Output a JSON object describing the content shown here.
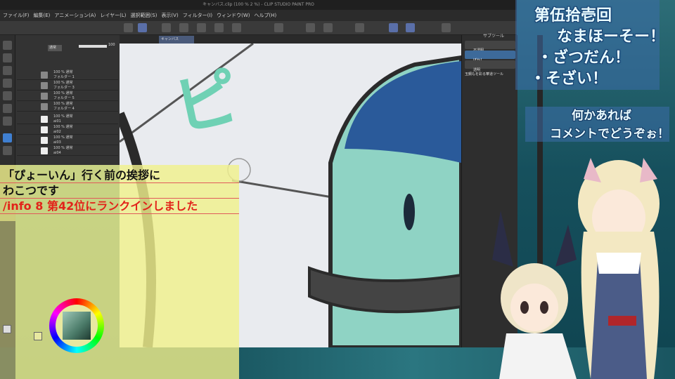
{
  "app": {
    "title": "キャンバス.clip (100 % 2 %) - CLIP STUDIO PAINT PRO",
    "menu": [
      "ファイル(F)",
      "編集(E)",
      "アニメーション(A)",
      "レイヤー(L)",
      "選択範囲(S)",
      "表示(V)",
      "フィルター(I)",
      "ウィンドウ(W)",
      "ヘルプ(H)"
    ]
  },
  "layers": {
    "rows": [
      {
        "name": "100 % 通常",
        "sub": "フォルダー 1"
      },
      {
        "name": "100 % 通常",
        "sub": "フォルダー 3"
      },
      {
        "name": "100 % 通常",
        "sub": "フォルダー 5"
      },
      {
        "name": "100 % 通常",
        "sub": "フォルダー 4"
      },
      {
        "name": "100 % 通常",
        "sub": "ai01"
      },
      {
        "name": "100 % 通常",
        "sub": "ai02"
      },
      {
        "name": "100 % 通常",
        "sub": "ai03"
      },
      {
        "name": "100 % 通常",
        "sub": "ai04"
      }
    ],
    "blend_mode": "通常",
    "opacity": "100"
  },
  "canvas": {
    "tab_label": "キャンバス",
    "drawn_text": "ピ",
    "colors": {
      "bg": "#e9ebef",
      "hair": "#2a5a9a",
      "face": "#8fd3c4",
      "outline": "#2b2b2b"
    }
  },
  "right_panel": {
    "tabs": [
      "サブツール",
      "ツール"
    ],
    "items": [
      "不透明",
      "ぼかし",
      "透明"
    ],
    "preset_label": "玉鋼もを彩る華道ツール"
  },
  "chat": {
    "lines": [
      {
        "text": "「ぴょーいん」行く前の挨拶に",
        "color": "black"
      },
      {
        "text": "わこつです",
        "color": "black"
      },
      {
        "text": "/info 8 第42位にランクインしました",
        "color": "red"
      }
    ]
  },
  "overlay": {
    "title_lines": [
      "第伍拾壱回",
      "なまほーそー！",
      "・ざつだん！",
      "・そざい！"
    ],
    "note_lines": [
      "何かあれば",
      "コメントでどうぞぉ！"
    ]
  }
}
